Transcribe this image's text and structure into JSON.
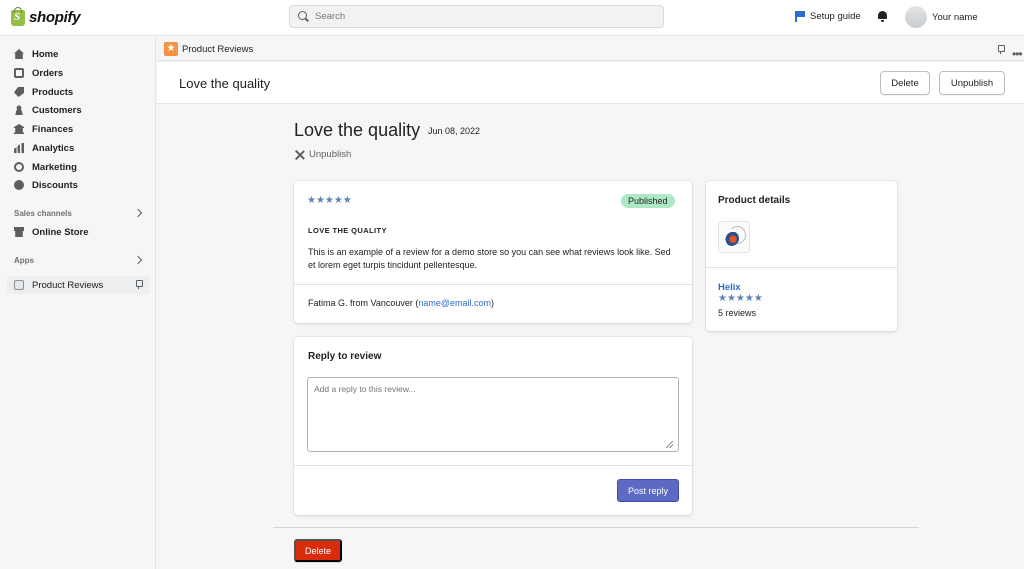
{
  "topbar": {
    "brand": "shopify",
    "search_placeholder": "Search",
    "setup_guide": "Setup guide",
    "user_name": "Your name"
  },
  "sidebar": {
    "items": [
      {
        "label": "Home",
        "icon": "home-icon"
      },
      {
        "label": "Orders",
        "icon": "orders-icon"
      },
      {
        "label": "Products",
        "icon": "tag-icon"
      },
      {
        "label": "Customers",
        "icon": "person-icon"
      },
      {
        "label": "Finances",
        "icon": "bank-icon"
      },
      {
        "label": "Analytics",
        "icon": "bar-chart-icon"
      },
      {
        "label": "Marketing",
        "icon": "target-icon"
      },
      {
        "label": "Discounts",
        "icon": "discount-icon"
      }
    ],
    "sales_channels_label": "Sales channels",
    "online_store": "Online Store",
    "apps_label": "Apps",
    "active_app": "Product Reviews"
  },
  "appbar": {
    "app_name": "Product Reviews",
    "more_glyph": "•••"
  },
  "titlebar": {
    "title": "Love the quality",
    "delete_label": "Delete",
    "unpublish_label": "Unpublish"
  },
  "review": {
    "title": "Love the quality",
    "date": "Jun 08, 2022",
    "unpublish_link": "Unpublish",
    "rating": 5,
    "stars": "★★★★★",
    "status": "Published",
    "heading": "LOVE THE QUALITY",
    "body": "This is an example of a review for a demo store so you can see what reviews look like. Sed et lorem eget turpis tincidunt pellentesque.",
    "author": "Fatima G. from Vancouver",
    "email_open": " (",
    "email": "name@email.com",
    "email_close": ")"
  },
  "reply": {
    "title": "Reply to review",
    "placeholder": "Add a reply to this review...",
    "post_label": "Post reply"
  },
  "product": {
    "section_title": "Product details",
    "name": "Helix",
    "rating": 4.5,
    "stars": "★★★★★",
    "reviews_count": "5 reviews"
  },
  "footer": {
    "delete_label": "Delete"
  },
  "colors": {
    "accent": "#5c6ac4",
    "danger": "#d82c0d",
    "published_badge": "#aee9c5",
    "link": "#2c6ecb",
    "app_logo": "#f49342"
  }
}
